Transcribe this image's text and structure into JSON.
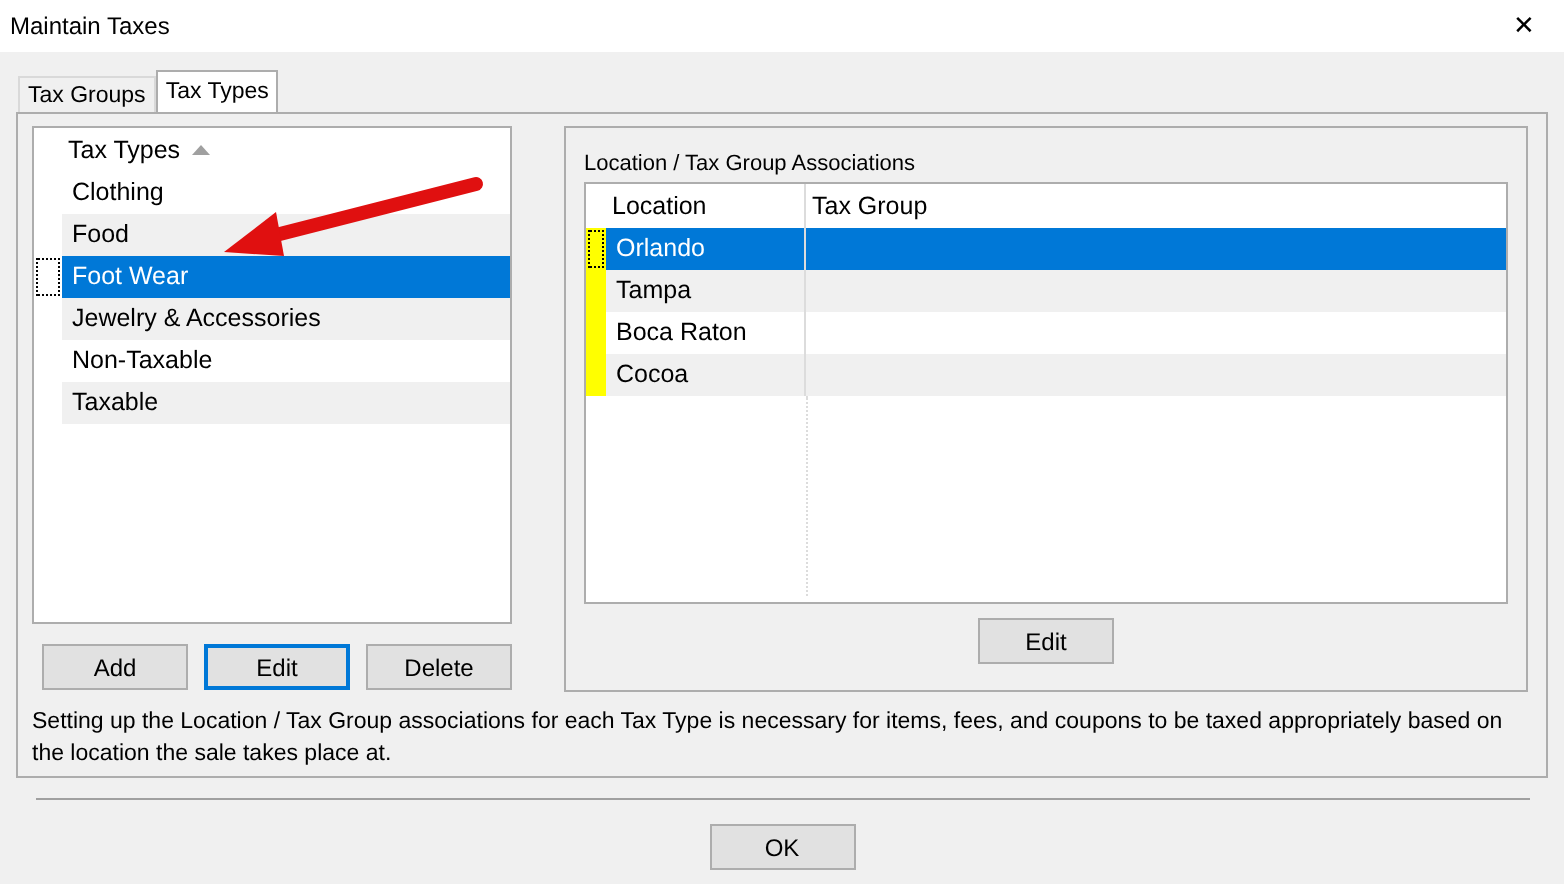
{
  "window": {
    "title": "Maintain Taxes",
    "close": "✕"
  },
  "tabs": [
    {
      "label": "Tax Groups",
      "selected": false
    },
    {
      "label": "Tax Types",
      "selected": true
    }
  ],
  "tax_types": {
    "column": "Tax Types",
    "sorted_ascending": true,
    "rows": [
      {
        "name": "Clothing",
        "selected": false
      },
      {
        "name": "Food",
        "selected": false
      },
      {
        "name": "Foot Wear",
        "selected": true
      },
      {
        "name": "Jewelry & Accessories",
        "selected": false
      },
      {
        "name": "Non-Taxable",
        "selected": false
      },
      {
        "name": "Taxable",
        "selected": false
      }
    ],
    "buttons": [
      {
        "label": "Add",
        "focused": false
      },
      {
        "label": "Edit",
        "focused": true
      },
      {
        "label": "Delete",
        "focused": false
      }
    ]
  },
  "associations": {
    "title": "Location / Tax Group Associations",
    "columns": [
      "Location",
      "Tax Group"
    ],
    "rows": [
      {
        "location": "Orlando",
        "selected": true,
        "flagged": true
      },
      {
        "location": "Tampa",
        "selected": false,
        "flagged": true
      },
      {
        "location": "Boca Raton",
        "selected": false,
        "flagged": true
      },
      {
        "location": "Cocoa",
        "selected": false,
        "flagged": true
      }
    ],
    "button": "Edit"
  },
  "help_text": "Setting up the Location / Tax Group associations for each Tax Type is necessary for items, fees, and coupons to be taxed appropriately based on the location the sale takes place at.",
  "ok_button": "OK",
  "annotation": {
    "kind": "arrow"
  }
}
